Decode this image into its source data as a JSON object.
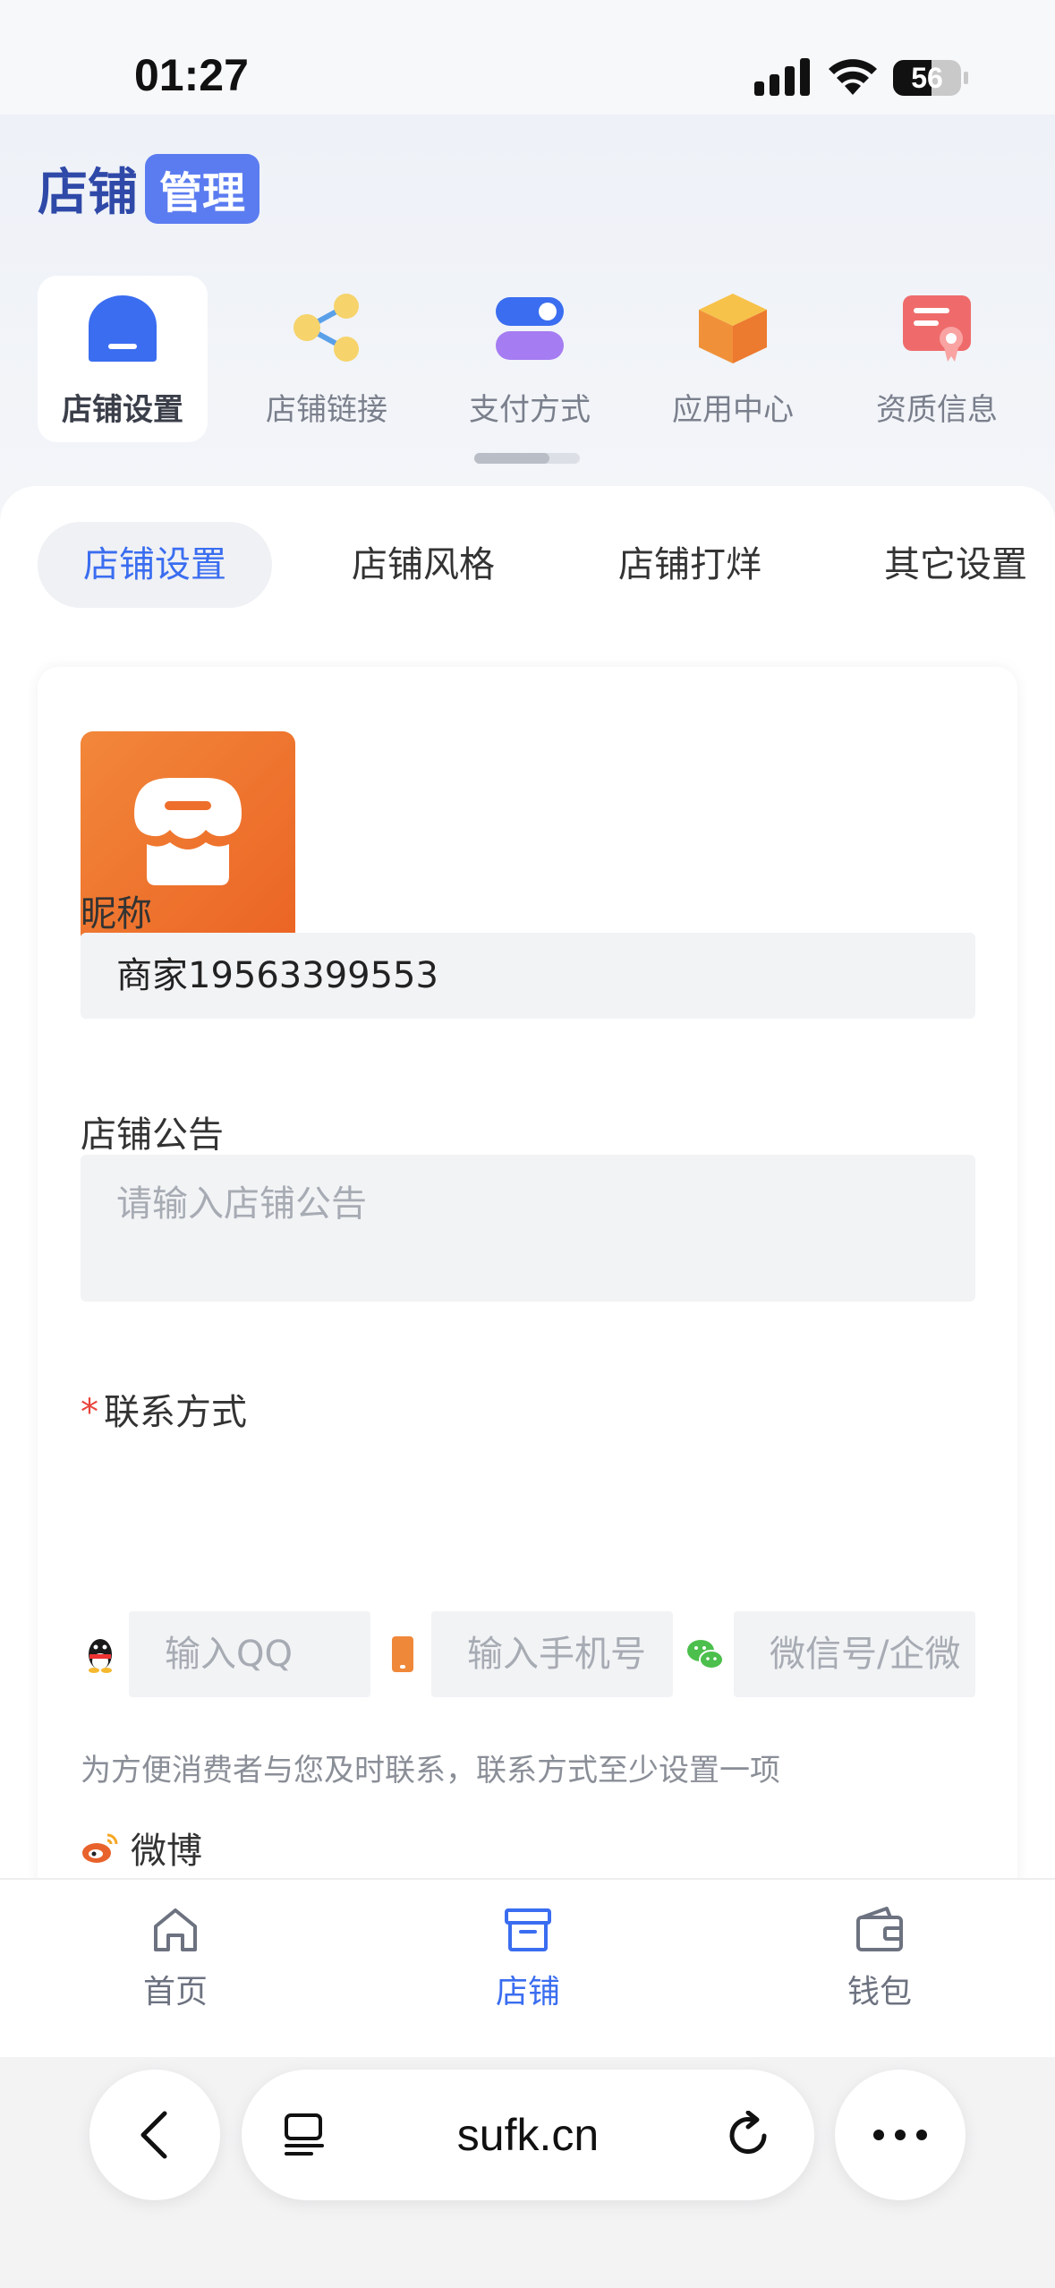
{
  "status_bar": {
    "time": "01:27",
    "battery": "56",
    "battery_level": 0.56
  },
  "header": {
    "brand_main": "店铺",
    "brand_tag": "管理"
  },
  "nav_items": [
    {
      "label": "店铺设置",
      "icon": "store-home-icon",
      "active": true
    },
    {
      "label": "店铺链接",
      "icon": "share-link-icon",
      "active": false
    },
    {
      "label": "支付方式",
      "icon": "payment-toggle-icon",
      "active": false
    },
    {
      "label": "应用中心",
      "icon": "app-box-icon",
      "active": false
    },
    {
      "label": "资质信息",
      "icon": "certificate-icon",
      "active": false
    }
  ],
  "tabs": [
    {
      "label": "店铺设置",
      "active": true
    },
    {
      "label": "店铺风格",
      "active": false
    },
    {
      "label": "店铺打烊",
      "active": false
    },
    {
      "label": "其它设置",
      "active": false
    }
  ],
  "form": {
    "nickname_label": "昵称",
    "nickname_value": "商家19563399553",
    "notice_label": "店铺公告",
    "notice_placeholder": "请输入店铺公告",
    "contact_required": "*",
    "contact_label": "联系方式",
    "qq_placeholder": "输入QQ",
    "phone_placeholder": "输入手机号",
    "wechat_placeholder": "微信号/企微",
    "contact_hint": "为方便消费者与您及时联系，联系方式至少设置一项",
    "weibo_label": "微博"
  },
  "bottom_nav": [
    {
      "label": "首页",
      "icon": "home-icon",
      "active": false
    },
    {
      "label": "店铺",
      "icon": "store-box-icon",
      "active": true
    },
    {
      "label": "钱包",
      "icon": "wallet-icon",
      "active": false
    }
  ],
  "browser": {
    "url": "sufk.cn"
  },
  "colors": {
    "accent": "#3a6df0",
    "brand": "#2f49a8",
    "logo_orange": "#ee6e2c",
    "required": "#e8453c"
  }
}
